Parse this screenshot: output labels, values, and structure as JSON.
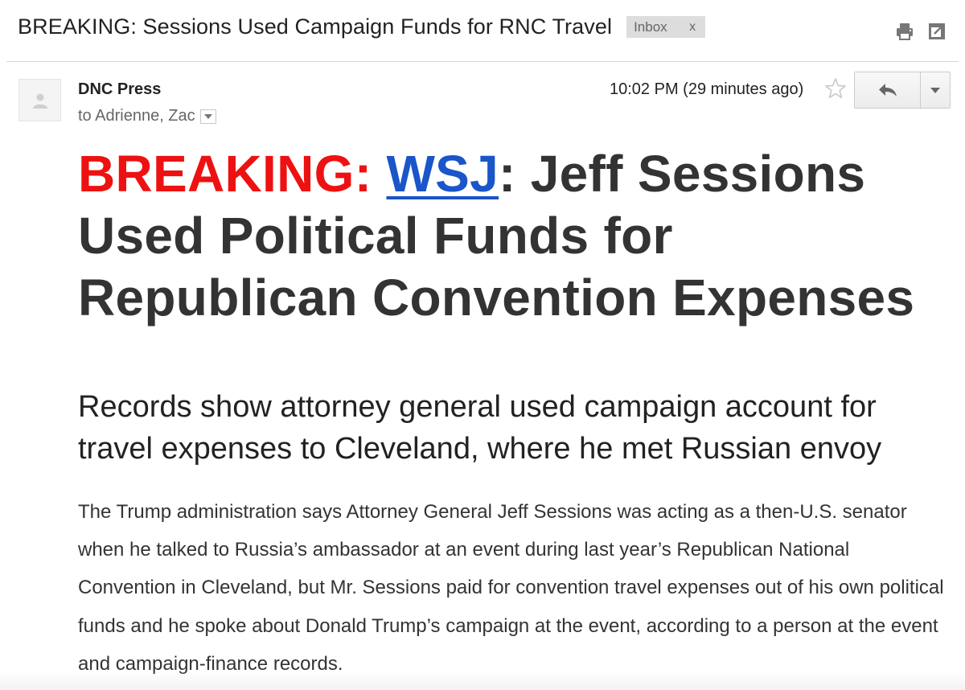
{
  "subject": {
    "title": "BREAKING: Sessions Used Campaign Funds for RNC Travel",
    "label": "Inbox",
    "label_remove": "x"
  },
  "icons": {
    "print": "print-icon",
    "open_new_window": "new-window-icon",
    "avatar": "person-icon",
    "star": "star-icon",
    "reply": "reply-icon",
    "more": "chevron-down-icon"
  },
  "sender": {
    "name": "DNC Press",
    "recipients": "to Adrienne, Zac"
  },
  "meta": {
    "timestamp": "10:02 PM (29 minutes ago)"
  },
  "body": {
    "headline_prefix": "BREAKING:",
    "headline_link": "WSJ",
    "headline_rest": ": Jeff Sessions Used Political Funds for Republican Convention Expenses",
    "subhead": "Records show attorney general used campaign account for travel expenses to Cleveland, where he met Russian envoy",
    "paragraph": "The Trump administration says Attorney General Jeff Sessions was acting as a then-U.S. senator when he talked to Russia’s ambassador at an event during last year’s Republican National Convention in Cleveland, but Mr. Sessions paid for convention travel expenses out of his own political funds and he spoke about Donald Trump’s campaign at the event, according to a person at the event and campaign-finance records."
  },
  "colors": {
    "breaking_red": "#ee1111",
    "link_blue": "#1a55c9",
    "label_bg": "#dddddd"
  }
}
